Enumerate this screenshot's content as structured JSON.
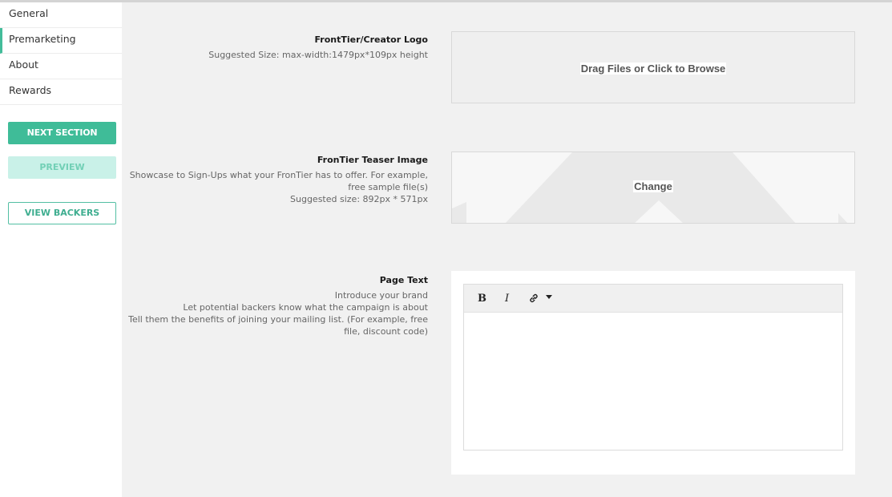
{
  "sidebar": {
    "items": [
      {
        "label": "General"
      },
      {
        "label": "Premarketing"
      },
      {
        "label": "About"
      },
      {
        "label": "Rewards"
      }
    ],
    "active_item": "Premarketing",
    "next_section_label": "NEXT SECTION",
    "preview_label": "PREVIEW",
    "view_backers_label": "VIEW BACKERS"
  },
  "logo_section": {
    "title": "FrontTier/Creator Logo",
    "hint": "Suggested Size: max-width:1479px*109px height",
    "dropzone_text": "Drag Files or Click to Browse"
  },
  "teaser_section": {
    "title": "FronTier Teaser Image",
    "description_lines": [
      "Showcase to Sign-Ups what your FronTier has to offer. For example,",
      "free sample file(s)",
      "Suggested size: 892px * 571px"
    ],
    "change_label": "Change"
  },
  "page_text_section": {
    "title": "Page Text",
    "description_lines": [
      "Introduce your brand",
      "Let potential backers know what the campaign is about",
      "Tell them the benefits of joining your mailing list. (For example, free",
      "file, discount code)"
    ],
    "editor": {
      "bold_label": "B",
      "italic_label": "I",
      "content": ""
    }
  },
  "colors": {
    "accent": "#3fbc98",
    "accent_light": "#c9f1e8",
    "background": "#f1f1f1"
  }
}
